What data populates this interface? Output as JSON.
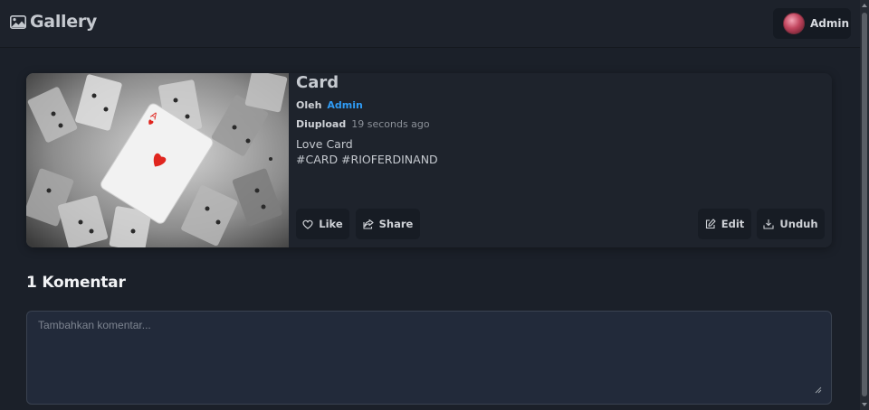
{
  "brand": {
    "label": "Gallery",
    "icon": "image-icon"
  },
  "user": {
    "name": "Admin",
    "avatar_icon": "avatar"
  },
  "post": {
    "title": "Card",
    "by_label": "Oleh",
    "author": "Admin",
    "uploaded_label": "Diupload",
    "uploaded_time": "19 seconds ago",
    "description": "Love Card",
    "tags": "#CARD #RIOFERDINAND",
    "image_alt": "Ace of hearts playing card on scattered cards (black and white)"
  },
  "actions": {
    "like": "Like",
    "share": "Share",
    "edit": "Edit",
    "download": "Unduh"
  },
  "comments": {
    "title": "1 Komentar",
    "placeholder": "Tambahkan komentar..."
  },
  "colors": {
    "background": "#1b2029",
    "card": "#1e232c",
    "accent_link": "#2f9bf5",
    "card_heart": "#e0261f"
  }
}
